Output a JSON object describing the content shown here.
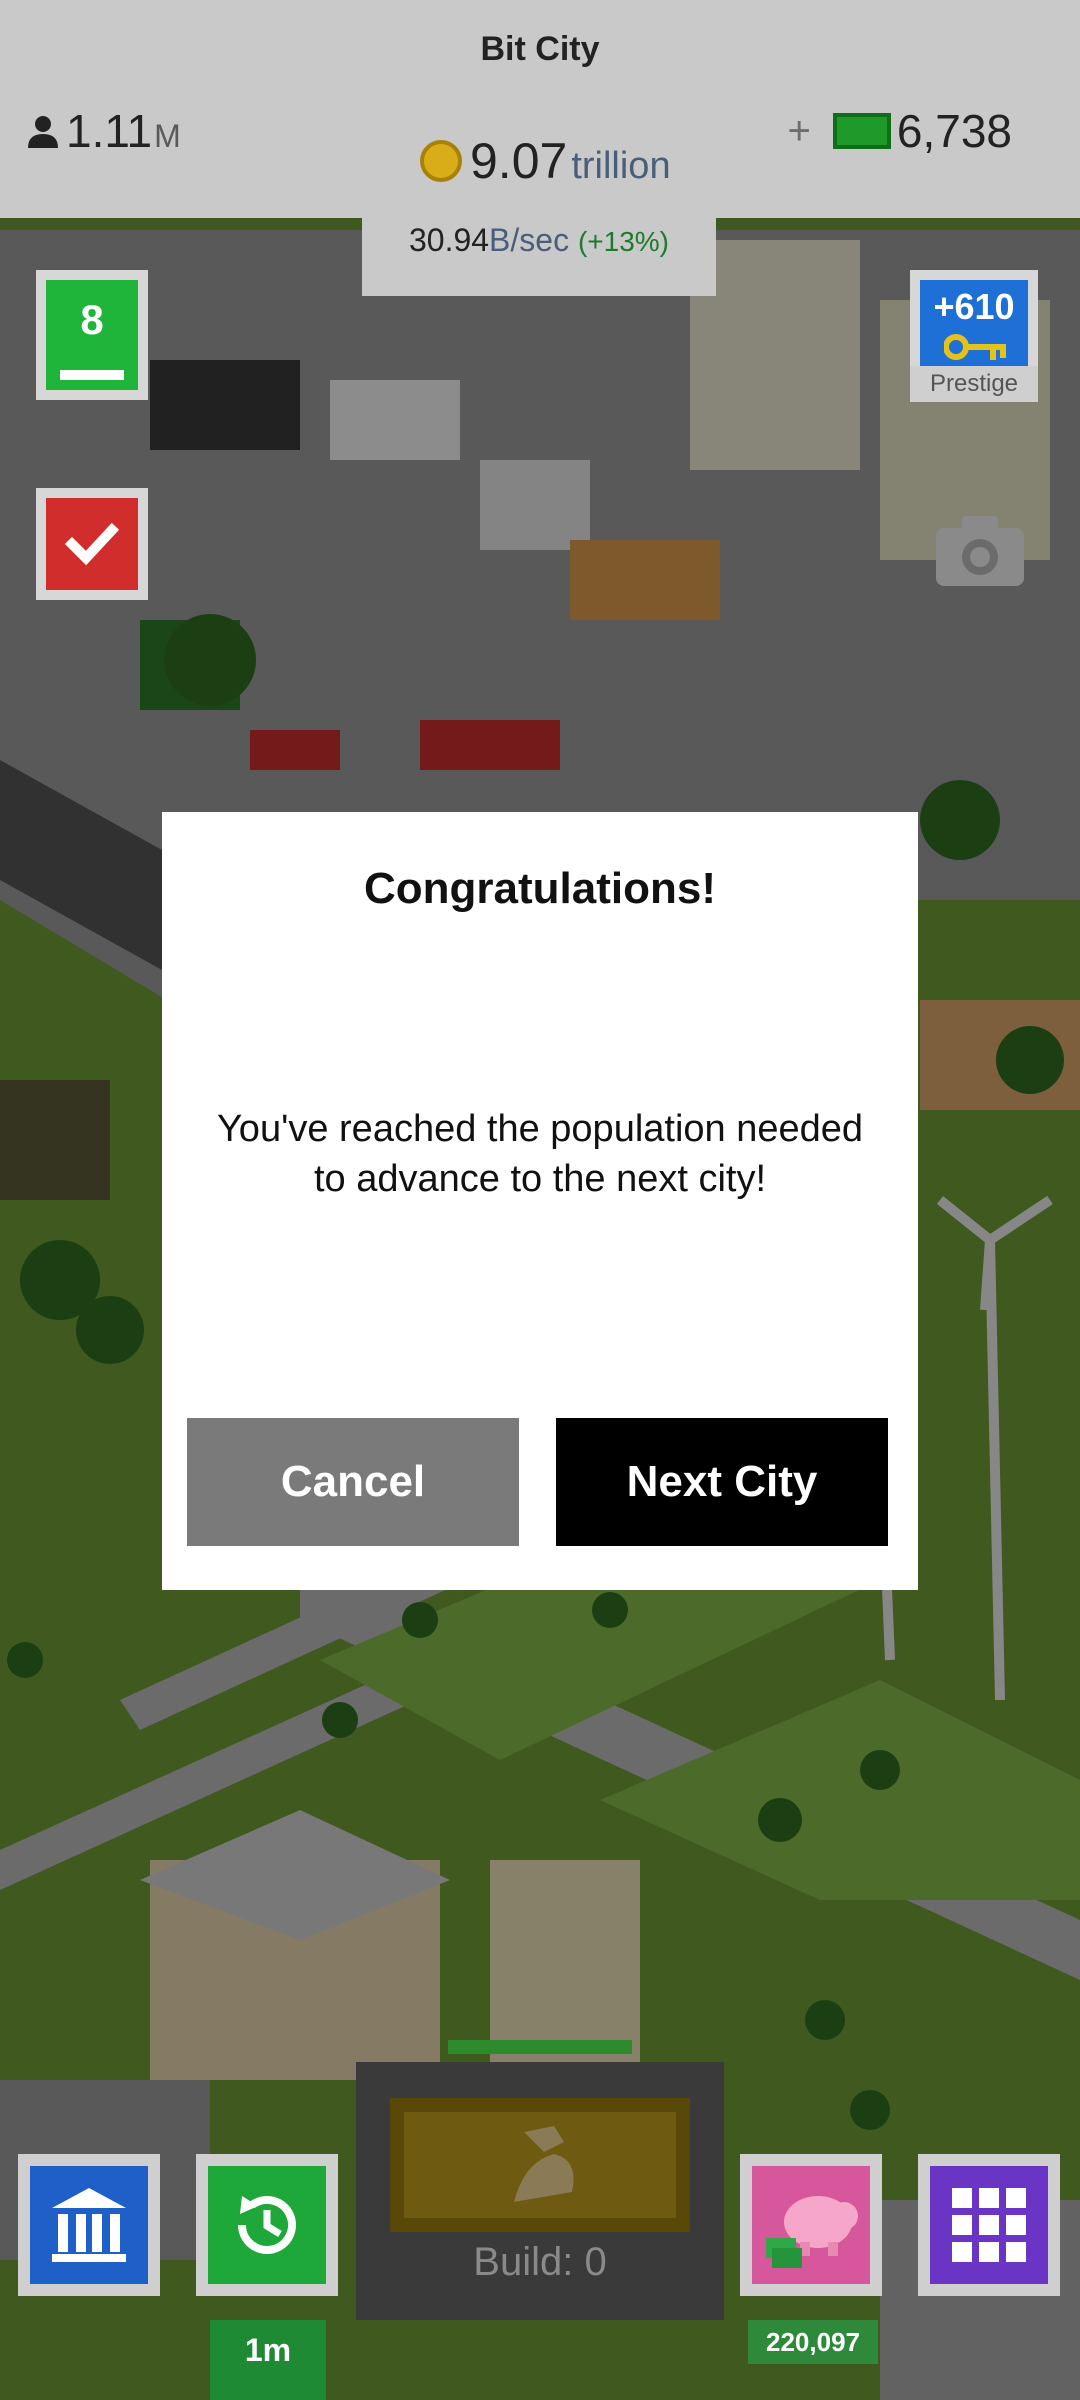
{
  "header": {
    "city_name": "Bit City",
    "population_value": "1.11",
    "population_unit": "M",
    "coins_value": "9.07",
    "coins_unit": "trillion",
    "rate_value": "30.94",
    "rate_unit": "B/sec",
    "rate_percent": "(+13%)",
    "cash_plus": "+",
    "cash_value": "6,738"
  },
  "side": {
    "level": "8",
    "prestige_amount": "+610",
    "prestige_label": "Prestige"
  },
  "dialog": {
    "title": "Congratulations!",
    "message": "You've reached the population needed to advance to the next city!",
    "cancel_label": "Cancel",
    "next_label": "Next City"
  },
  "bottom": {
    "time_label": "1m",
    "piggy_amount": "220,097",
    "build_label": "Build: 0"
  },
  "colors": {
    "accent_green": "#1fb53a",
    "prestige_blue": "#1e6fd6",
    "check_red": "#d22d2d",
    "grid_purple": "#6a35c4",
    "piggy_pink": "#d6579b"
  }
}
